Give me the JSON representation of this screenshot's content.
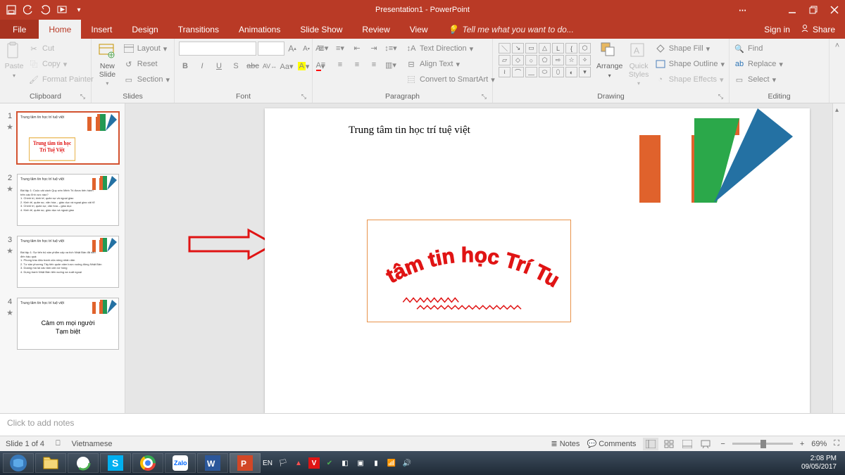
{
  "window": {
    "title": "Presentation1 - PowerPoint",
    "signin": "Sign in",
    "share": "Share"
  },
  "tabs": {
    "file": "File",
    "home": "Home",
    "insert": "Insert",
    "design": "Design",
    "transitions": "Transitions",
    "animations": "Animations",
    "slideshow": "Slide Show",
    "review": "Review",
    "view": "View",
    "tellme": "Tell me what you want to do..."
  },
  "ribbon": {
    "clipboard": {
      "label": "Clipboard",
      "paste": "Paste",
      "cut": "Cut",
      "copy": "Copy",
      "format_painter": "Format Painter"
    },
    "slides": {
      "label": "Slides",
      "new_slide": "New\nSlide",
      "layout": "Layout",
      "reset": "Reset",
      "section": "Section"
    },
    "font": {
      "label": "Font",
      "increase": "A",
      "decrease": "A"
    },
    "paragraph": {
      "label": "Paragraph",
      "text_direction": "Text Direction",
      "align_text": "Align Text",
      "smartart": "Convert to SmartArt"
    },
    "drawing": {
      "label": "Drawing",
      "arrange": "Arrange",
      "quick_styles": "Quick\nStyles",
      "shape_fill": "Shape Fill",
      "shape_outline": "Shape Outline",
      "shape_effects": "Shape Effects"
    },
    "editing": {
      "label": "Editing",
      "find": "Find",
      "replace": "Replace",
      "select": "Select"
    }
  },
  "slide": {
    "title": "Trung tâm tin học trí tuệ việt",
    "wordart": "Trung tâm tin học Trí Tuệ Việt",
    "slide4_line1": "Cảm ơn mọi người",
    "slide4_line2": "Tạm biệt"
  },
  "notes_placeholder": "Click to add notes",
  "status": {
    "slide_count": "Slide 1 of 4",
    "language": "Vietnamese",
    "notes": "Notes",
    "comments": "Comments",
    "zoom": "69%"
  },
  "system": {
    "lang": "EN",
    "time": "2:08 PM",
    "date": "09/05/2017"
  }
}
